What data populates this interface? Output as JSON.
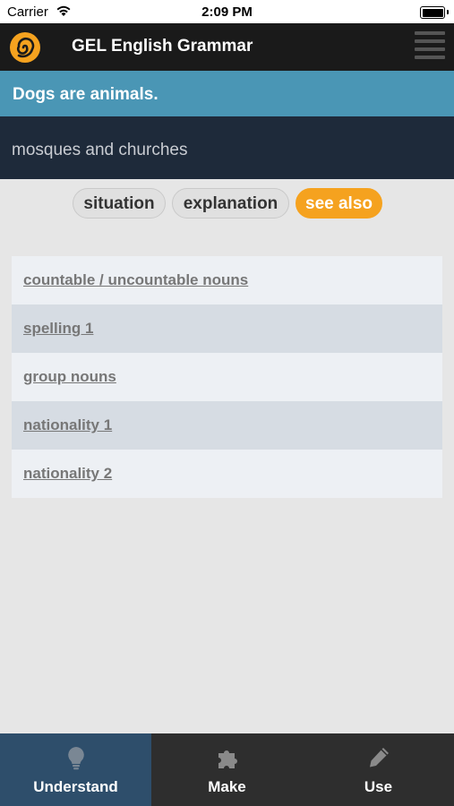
{
  "status_bar": {
    "carrier": "Carrier",
    "time": "2:09 PM"
  },
  "header": {
    "title": "GEL English Grammar",
    "logo_icon": "spiral-logo",
    "menu_icon": "hamburger-menu"
  },
  "sentence": {
    "text": "Dogs are animals."
  },
  "subtitle": {
    "text": "mosques and churches"
  },
  "tabs": [
    {
      "label": "situation",
      "active": false
    },
    {
      "label": "explanation",
      "active": false
    },
    {
      "label": "see also",
      "active": true
    }
  ],
  "see_also_links": [
    {
      "label": "countable / uncountable nouns"
    },
    {
      "label": "spelling 1"
    },
    {
      "label": "group nouns"
    },
    {
      "label": "nationality 1"
    },
    {
      "label": "nationality 2"
    }
  ],
  "tabbar": {
    "items": [
      {
        "label": "Understand",
        "icon": "lightbulb-icon",
        "active": true
      },
      {
        "label": "Make",
        "icon": "puzzle-icon",
        "active": false
      },
      {
        "label": "Use",
        "icon": "pencil-icon",
        "active": false
      }
    ]
  },
  "colors": {
    "accent": "#f5a21f",
    "sentence_bar": "#4a96b5",
    "sub_bar": "#1e2a3a",
    "active_tab": "#2e4e6b"
  }
}
